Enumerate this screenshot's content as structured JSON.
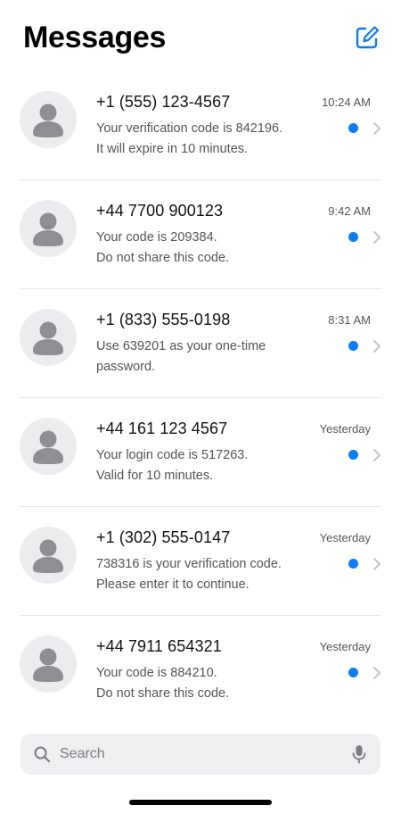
{
  "header": {
    "title": "Messages",
    "compose_icon": "compose-icon",
    "accent_color": "#0a7cf5"
  },
  "conversations": [
    {
      "sender": "+1 (555) 123-4567",
      "time": "10:24 AM",
      "preview_line1": "Your verification code is 842196.",
      "preview_line2": "It will expire in 10 minutes.",
      "unread": true
    },
    {
      "sender": "+44 7700 900123",
      "time": "9:42 AM",
      "preview_line1": "Your code is 209384.",
      "preview_line2": "Do not share this code.",
      "unread": true
    },
    {
      "sender": "+1 (833) 555-0198",
      "time": "8:31 AM",
      "preview_line1": "Use 639201 as your one-time",
      "preview_line2": "password.",
      "unread": true
    },
    {
      "sender": "+44 161 123 4567",
      "time": "Yesterday",
      "preview_line1": "Your login code is 517263.",
      "preview_line2": "Valid for 10 minutes.",
      "unread": true
    },
    {
      "sender": "+1 (302) 555-0147",
      "time": "Yesterday",
      "preview_line1": "738316 is your verification code.",
      "preview_line2": "Please enter it to continue.",
      "unread": true
    },
    {
      "sender": "+44 7911 654321",
      "time": "Yesterday",
      "preview_line1": "Your code is 884210.",
      "preview_line2": "Do not share this code.",
      "unread": true
    }
  ],
  "search": {
    "placeholder": "Search",
    "search_icon": "search-icon",
    "mic_icon": "microphone-icon"
  },
  "colors": {
    "unread_dot": "#0a7cf5",
    "avatar_bg": "#ececee",
    "avatar_fg": "#8e8e93",
    "search_bg": "#efeff1"
  }
}
